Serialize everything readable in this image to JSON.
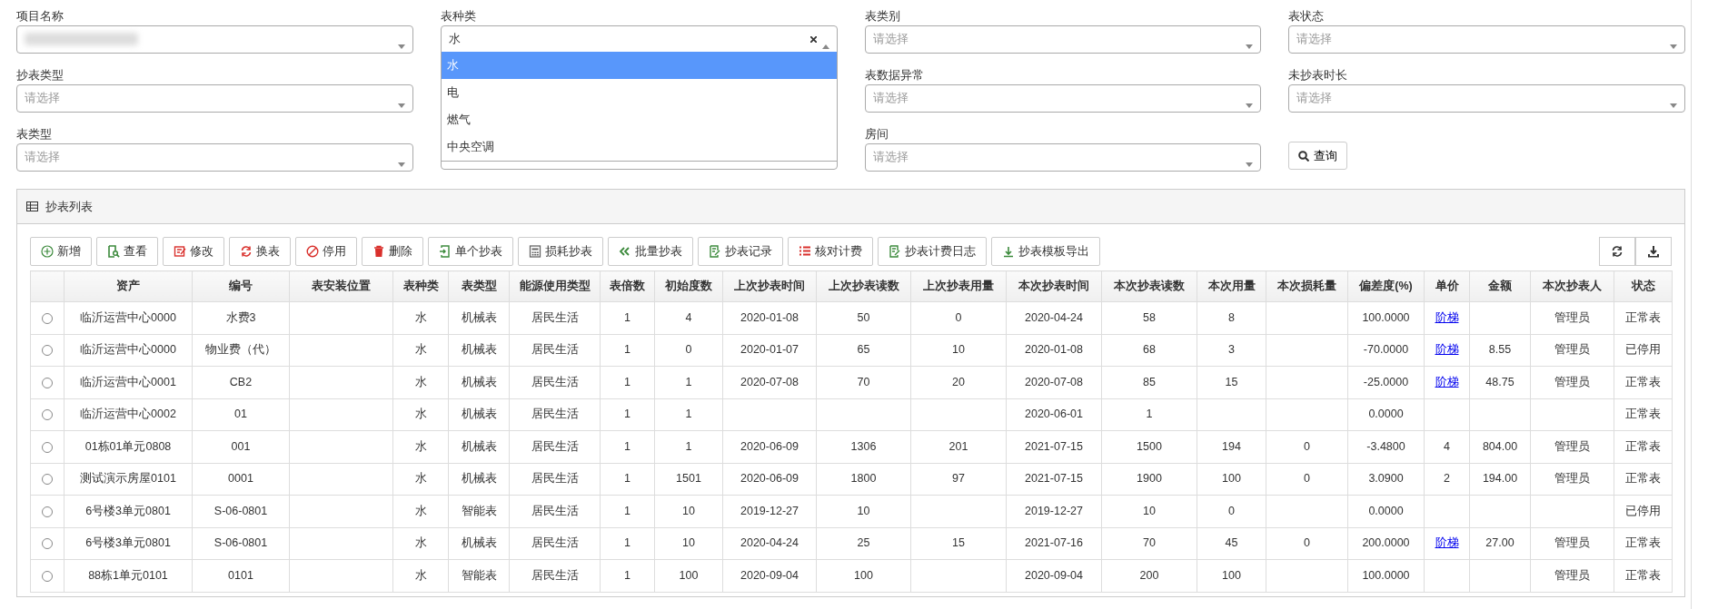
{
  "filters": [
    [
      {
        "kind": "select",
        "label": "项目名称",
        "redacted": true,
        "open": false
      },
      {
        "kind": "select",
        "label": "表种类",
        "value": "水",
        "open": true,
        "clearable": true,
        "options": [
          {
            "label": "水",
            "selected": true
          },
          {
            "label": "电",
            "selected": false
          },
          {
            "label": "燃气",
            "selected": false
          },
          {
            "label": "中央空调",
            "selected": false
          }
        ]
      },
      {
        "kind": "select",
        "label": "表类别",
        "placeholder": "请选择",
        "open": false
      },
      {
        "kind": "select",
        "label": "表状态",
        "placeholder": "请选择",
        "open": false
      }
    ],
    [
      {
        "kind": "select",
        "label": "抄表类型",
        "placeholder": "请选择",
        "open": false
      },
      {
        "kind": "select",
        "label": "表数据异常",
        "placeholder": "请选择",
        "open": false
      },
      {
        "kind": "select",
        "label": "未抄表时长",
        "placeholder": "请选择",
        "open": false
      }
    ],
    [
      {
        "kind": "select",
        "label": "表类型",
        "placeholder": "请选择",
        "open": false
      },
      {
        "kind": "covered"
      },
      {
        "kind": "select",
        "label": "房间",
        "placeholder": "请选择",
        "open": false
      },
      {
        "kind": "button",
        "label": "查询"
      }
    ]
  ],
  "panel": {
    "title": "抄表列表",
    "toolbar": [
      "新增",
      "查看",
      "修改",
      "换表",
      "停用",
      "删除",
      "单个抄表",
      "损耗抄表",
      "批量抄表",
      "抄表记录",
      "核对计费",
      "抄表计费日志",
      "抄表模板导出"
    ],
    "columns": [
      "资产",
      "编号",
      "表安装位置",
      "表种类",
      "表类型",
      "能源使用类型",
      "表倍数",
      "初始度数",
      "上次抄表时间",
      "上次抄表读数",
      "上次抄表用量",
      "本次抄表时间",
      "本次抄表读数",
      "本次用量",
      "本次损耗量",
      "偏差度(%)",
      "单价",
      "金额",
      "本次抄表人",
      "状态"
    ],
    "rows": [
      {
        "selected": false,
        "asset": "临沂运营中心0000",
        "code": "水费3",
        "category": "水",
        "type": "机械表",
        "energy": "居民生活",
        "multiplier": "1",
        "initial": "4",
        "last_time": "2020-01-08",
        "last_reading": "50",
        "last_usage": "0",
        "cur_time": "2020-04-24",
        "cur_reading": "58",
        "cur_usage": "8",
        "deviation": "100.0000",
        "unit_price": {
          "text": "阶梯",
          "kind": "link"
        },
        "reader": "管理员",
        "status": "正常表"
      },
      {
        "selected": false,
        "asset": "临沂运营中心0000",
        "code": "物业费（代）",
        "category": "水",
        "type": "机械表",
        "energy": "居民生活",
        "multiplier": "1",
        "initial": "0",
        "last_time": "2020-01-07",
        "last_reading": "65",
        "last_usage": "10",
        "cur_time": "2020-01-08",
        "cur_reading": "68",
        "cur_usage": "3",
        "deviation": "-70.0000",
        "unit_price": {
          "text": "阶梯",
          "kind": "link"
        },
        "amount": "8.55",
        "reader": "管理员",
        "status": "已停用"
      },
      {
        "selected": false,
        "asset": "临沂运营中心0001",
        "code": "CB2",
        "category": "水",
        "type": "机械表",
        "energy": "居民生活",
        "multiplier": "1",
        "initial": "1",
        "last_time": "2020-07-08",
        "last_reading": "70",
        "last_usage": "20",
        "cur_time": "2020-07-08",
        "cur_reading": "85",
        "cur_usage": "15",
        "deviation": "-25.0000",
        "unit_price": {
          "text": "阶梯",
          "kind": "link"
        },
        "amount": "48.75",
        "reader": "管理员",
        "status": "正常表"
      },
      {
        "selected": false,
        "asset": "临沂运营中心0002",
        "code": "01",
        "category": "水",
        "type": "机械表",
        "energy": "居民生活",
        "multiplier": "1",
        "initial": "1",
        "cur_time": "2020-06-01",
        "cur_reading": "1",
        "deviation": "0.0000",
        "status": "正常表"
      },
      {
        "selected": false,
        "asset": "01栋01单元0808",
        "code": "001",
        "category": "水",
        "type": "机械表",
        "energy": "居民生活",
        "multiplier": "1",
        "initial": "1",
        "last_time": "2020-06-09",
        "last_reading": "1306",
        "last_usage": "201",
        "cur_time": "2021-07-15",
        "cur_reading": "1500",
        "cur_usage": "194",
        "loss": "0",
        "deviation": "-3.4800",
        "unit_price": {
          "text": "4",
          "kind": "text"
        },
        "amount": "804.00",
        "reader": "管理员",
        "status": "正常表"
      },
      {
        "selected": false,
        "asset": "测试演示房屋0101",
        "code": "0001",
        "category": "水",
        "type": "机械表",
        "energy": "居民生活",
        "multiplier": "1",
        "initial": "1501",
        "last_time": "2020-06-09",
        "last_reading": "1800",
        "last_usage": "97",
        "cur_time": "2021-07-15",
        "cur_reading": "1900",
        "cur_usage": "100",
        "loss": "0",
        "deviation": "3.0900",
        "unit_price": {
          "text": "2",
          "kind": "text"
        },
        "amount": "194.00",
        "reader": "管理员",
        "status": "正常表"
      },
      {
        "selected": false,
        "asset": "6号楼3单元0801",
        "code": "S-06-0801",
        "category": "水",
        "type": "智能表",
        "energy": "居民生活",
        "multiplier": "1",
        "initial": "10",
        "last_time": "2019-12-27",
        "last_reading": "10",
        "cur_time": "2019-12-27",
        "cur_reading": "10",
        "cur_usage": "0",
        "deviation": "0.0000",
        "status": "已停用"
      },
      {
        "selected": false,
        "asset": "6号楼3单元0801",
        "code": "S-06-0801",
        "category": "水",
        "type": "机械表",
        "energy": "居民生活",
        "multiplier": "1",
        "initial": "10",
        "last_time": "2020-04-24",
        "last_reading": "25",
        "last_usage": "15",
        "cur_time": "2021-07-16",
        "cur_reading": "70",
        "cur_usage": "45",
        "loss": "0",
        "deviation": "200.0000",
        "unit_price": {
          "text": "阶梯",
          "kind": "link"
        },
        "amount": "27.00",
        "reader": "管理员",
        "status": "正常表"
      },
      {
        "selected": false,
        "asset": "88栋1单元0101",
        "code": "0101",
        "category": "水",
        "type": "智能表",
        "energy": "居民生活",
        "multiplier": "1",
        "initial": "100",
        "last_time": "2020-09-04",
        "last_reading": "100",
        "cur_time": "2020-09-04",
        "cur_reading": "200",
        "cur_usage": "100",
        "deviation": "100.0000",
        "reader": "管理员",
        "status": "正常表"
      }
    ]
  }
}
